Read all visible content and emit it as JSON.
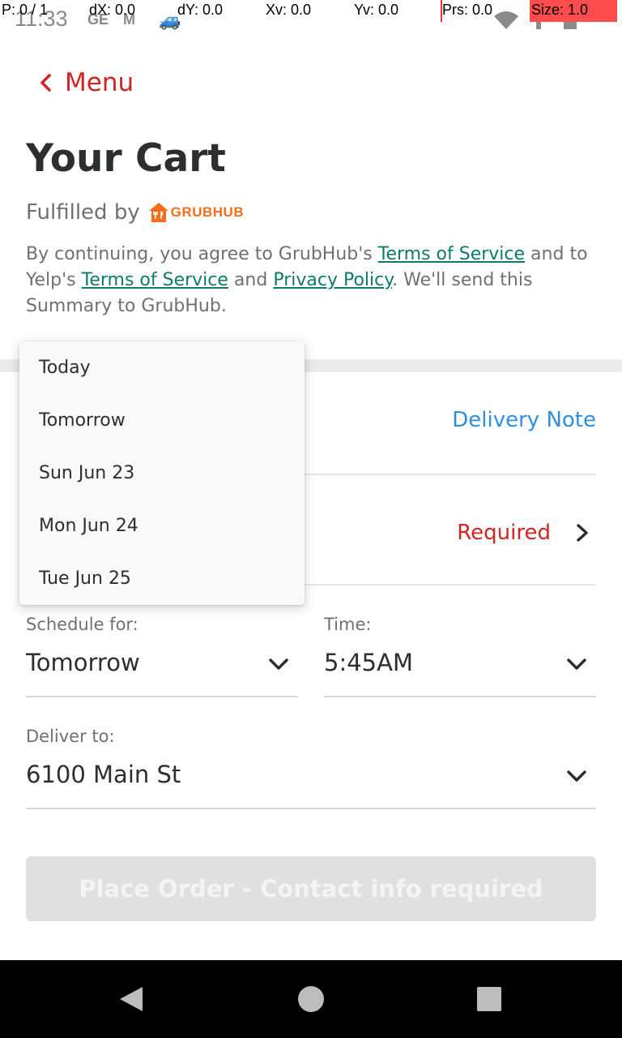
{
  "status_bar": {
    "time": "11:33",
    "debug": {
      "pointer": "P: 0 / 1",
      "dx": "dX: 0.0",
      "dy": "dY: 0.0",
      "xv": "Xv: 0.0",
      "yv": "Yv: 0.0",
      "prs": "Prs: 0.0",
      "size": "Size: 1.0"
    },
    "icons": [
      "notification-icon",
      "gmail-icon",
      "car-icon",
      "wifi-icon",
      "signal-icon",
      "battery-icon"
    ]
  },
  "header": {
    "back_label": "Menu",
    "title": "Your Cart",
    "fulfilled_by": "Fulfilled by",
    "brand": "GRUBHUB"
  },
  "terms": {
    "prefix": "By continuing, you agree to GrubHub's ",
    "link1": "Terms of Service",
    "mid1": " and to Yelp's ",
    "link2": "Terms of Service",
    "mid2": " and ",
    "link3": "Privacy Policy",
    "suffix": ". We'll send this Summary to GrubHub."
  },
  "delivery_note": "Delivery Note",
  "contact": {
    "status": "Required"
  },
  "schedule": {
    "label": "Schedule for:",
    "value": "Tomorrow"
  },
  "time": {
    "label": "Time:",
    "value": "5:45AM"
  },
  "deliver_to": {
    "label": "Deliver to:",
    "value": "6100 Main St"
  },
  "place_order": "Place Order - Contact info required",
  "dropdown": {
    "options": [
      "Today",
      "Tomorrow",
      "Sun Jun 23",
      "Mon Jun 24",
      "Tue Jun 25"
    ]
  },
  "colors": {
    "accent_red": "#d32323",
    "link_green": "#0d7a6a",
    "link_blue": "#2f8ee0",
    "grubhub_orange": "#f66e1c"
  }
}
